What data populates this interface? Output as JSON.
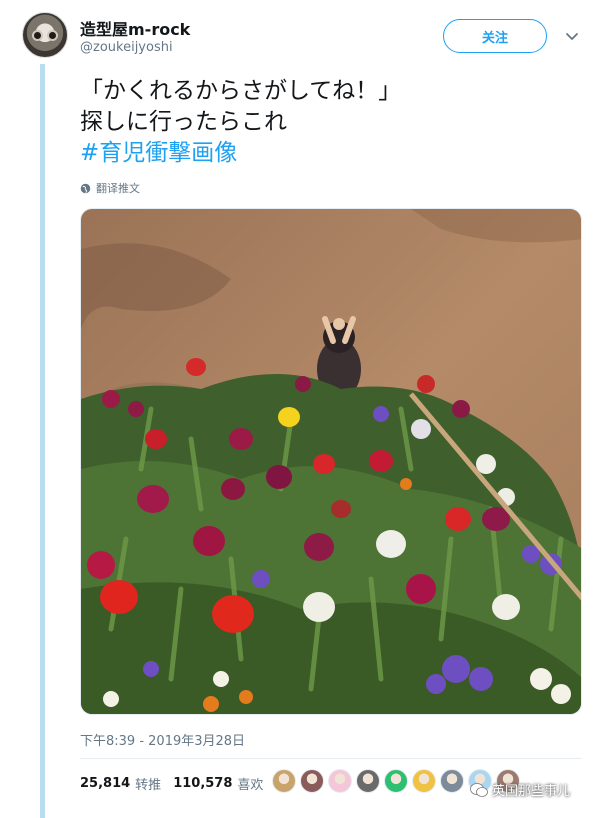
{
  "user": {
    "display_name": "造型屋m-rock",
    "handle": "@zoukeijyoshi"
  },
  "follow_button_label": "关注",
  "tweet": {
    "line1": "「かくれるからさがしてね！」",
    "line2": "探しに行ったらこれ",
    "hashtag": "#育児衝撃画像",
    "translate_label": "翻译推文",
    "timestamp": "下午8:39 - 2019年3月28日"
  },
  "stats": {
    "retweets": "25,814",
    "retweets_label": "转推",
    "likes": "110,578",
    "likes_label": "喜欢"
  },
  "liker_avatars": [
    "#c9a46a",
    "#8a5b5b",
    "#f3c6d8",
    "#6a6a6a",
    "#2fbf71",
    "#f0c244",
    "#7d8a99",
    "#a9d6f0",
    "#9b7b6e"
  ],
  "watermark": "英国那些事儿",
  "colors": {
    "accent": "#1da1f2",
    "muted": "#657786",
    "thread_line": "#b8ddf3"
  }
}
